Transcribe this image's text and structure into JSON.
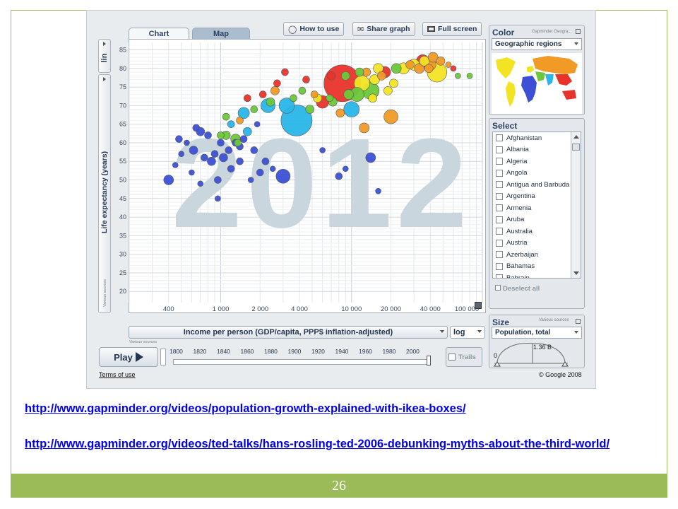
{
  "slide": {
    "page_number": "26",
    "links": [
      "http://www.gapminder.org/videos/population-growth-explained-with-ikea-boxes/",
      "http://www.gapminder.org/videos/ted-talks/hans-rosling-ted-2006-debunking-myths-about-the-third-world/"
    ]
  },
  "tabs": [
    "Chart",
    "Map"
  ],
  "top_buttons": [
    "How to use",
    "Share graph",
    "Full screen"
  ],
  "year": "2012",
  "y_axis": {
    "scale": "lin",
    "label": "Life expectancy (years)",
    "source_note": "Various sources"
  },
  "x_axis": {
    "label": "Income per person (GDP/capita, PPP$ inflation-adjusted)",
    "scale": "log",
    "source_note": "Various sources"
  },
  "color_panel": {
    "title": "Color",
    "source_note": "Gapminder Geogra...",
    "selected": "Geographic regions"
  },
  "select_panel": {
    "title": "Select",
    "countries": [
      "Afghanistan",
      "Albania",
      "Algeria",
      "Angola",
      "Antigua and Barbuda",
      "Argentina",
      "Armenia",
      "Aruba",
      "Australia",
      "Austria",
      "Azerbaijan",
      "Bahamas",
      "Bahrain"
    ],
    "deselect_label": "Deselect all"
  },
  "size_panel": {
    "title": "Size",
    "source_note": "Various sources",
    "selected": "Population, total",
    "min_value": "0",
    "max_value": "1.36 B"
  },
  "timeline": {
    "play_label": "Play",
    "years": [
      "1800",
      "1820",
      "1840",
      "1860",
      "1880",
      "1900",
      "1920",
      "1940",
      "1960",
      "1980",
      "2000"
    ],
    "trails_label": "Trails"
  },
  "terms_label": "Terms of use",
  "copyright": "© Google 2008",
  "chart_data": {
    "type": "scatter",
    "title": "",
    "xlabel": "Income per person (GDP/capita, PPP$ inflation-adjusted)",
    "ylabel": "Life expectancy (years)",
    "x_scale": "log",
    "xlim": [
      200,
      100000
    ],
    "ylim": [
      17,
      87
    ],
    "x_ticks": [
      "400",
      "1 000",
      "2 000",
      "4 000",
      "10 000",
      "20 000",
      "40 000",
      "100 000"
    ],
    "y_ticks": [
      20,
      25,
      30,
      35,
      40,
      45,
      50,
      55,
      60,
      65,
      70,
      75,
      80,
      85
    ],
    "grid": true,
    "year": "2012",
    "colors": {
      "africa": "#3c50d6",
      "south_asia": "#29b6e8",
      "east_asia": "#e8332a",
      "americas": "#6cc83a",
      "europe_central_asia": "#f2e425",
      "middle_east": "#f19a26"
    },
    "points": [
      {
        "x": 8500,
        "y": 76,
        "r": 26,
        "c": "east_asia"
      },
      {
        "x": 3800,
        "y": 66,
        "r": 22,
        "c": "south_asia"
      },
      {
        "x": 45000,
        "y": 79,
        "r": 14,
        "c": "europe_central_asia"
      },
      {
        "x": 3000,
        "y": 51,
        "r": 10,
        "c": "africa"
      },
      {
        "x": 3200,
        "y": 70,
        "r": 11,
        "c": "south_asia"
      },
      {
        "x": 14000,
        "y": 74,
        "r": 12,
        "c": "americas"
      },
      {
        "x": 12000,
        "y": 76,
        "r": 11,
        "c": "europe_central_asia"
      },
      {
        "x": 11000,
        "y": 73,
        "r": 10,
        "c": "americas"
      },
      {
        "x": 6000,
        "y": 71,
        "r": 9,
        "c": "east_asia"
      },
      {
        "x": 2300,
        "y": 70,
        "r": 10,
        "c": "south_asia"
      },
      {
        "x": 10000,
        "y": 69,
        "r": 11,
        "c": "south_asia"
      },
      {
        "x": 20000,
        "y": 67,
        "r": 10,
        "c": "middle_east"
      },
      {
        "x": 1500,
        "y": 68,
        "r": 8,
        "c": "south_asia"
      },
      {
        "x": 35000,
        "y": 82,
        "r": 9,
        "c": "east_asia"
      },
      {
        "x": 40000,
        "y": 81,
        "r": 8,
        "c": "middle_east"
      },
      {
        "x": 33000,
        "y": 80,
        "r": 7,
        "c": "middle_east"
      },
      {
        "x": 36000,
        "y": 82,
        "r": 7,
        "c": "europe_central_asia"
      },
      {
        "x": 30000,
        "y": 81,
        "r": 8,
        "c": "europe_central_asia"
      },
      {
        "x": 25000,
        "y": 80,
        "r": 8,
        "c": "europe_central_asia"
      },
      {
        "x": 22000,
        "y": 80,
        "r": 7,
        "c": "americas"
      },
      {
        "x": 18000,
        "y": 79,
        "r": 8,
        "c": "east_asia"
      },
      {
        "x": 15000,
        "y": 77,
        "r": 7,
        "c": "europe_central_asia"
      },
      {
        "x": 16000,
        "y": 80,
        "r": 7,
        "c": "europe_central_asia"
      },
      {
        "x": 42000,
        "y": 83,
        "r": 7,
        "c": "middle_east"
      },
      {
        "x": 28000,
        "y": 81,
        "r": 6,
        "c": "middle_east"
      },
      {
        "x": 39000,
        "y": 80,
        "r": 6,
        "c": "middle_east"
      },
      {
        "x": 48000,
        "y": 82,
        "r": 6,
        "c": "middle_east"
      },
      {
        "x": 13000,
        "y": 79,
        "r": 6,
        "c": "middle_east"
      },
      {
        "x": 17000,
        "y": 78,
        "r": 6,
        "c": "middle_east"
      },
      {
        "x": 11500,
        "y": 79,
        "r": 6,
        "c": "americas"
      },
      {
        "x": 9000,
        "y": 78,
        "r": 6,
        "c": "americas"
      },
      {
        "x": 7000,
        "y": 78,
        "r": 6,
        "c": "east_asia"
      },
      {
        "x": 21000,
        "y": 76,
        "r": 6,
        "c": "europe_central_asia"
      },
      {
        "x": 19000,
        "y": 74,
        "r": 6,
        "c": "europe_central_asia"
      },
      {
        "x": 14500,
        "y": 72,
        "r": 6,
        "c": "europe_central_asia"
      },
      {
        "x": 9500,
        "y": 73,
        "r": 7,
        "c": "americas"
      },
      {
        "x": 7200,
        "y": 71,
        "r": 6,
        "c": "americas"
      },
      {
        "x": 5500,
        "y": 72,
        "r": 6,
        "c": "europe_central_asia"
      },
      {
        "x": 4800,
        "y": 69,
        "r": 6,
        "c": "americas"
      },
      {
        "x": 6800,
        "y": 72,
        "r": 5,
        "c": "americas"
      },
      {
        "x": 5200,
        "y": 73,
        "r": 5,
        "c": "middle_east"
      },
      {
        "x": 4200,
        "y": 74,
        "r": 5,
        "c": "americas"
      },
      {
        "x": 3600,
        "y": 72,
        "r": 5,
        "c": "americas"
      },
      {
        "x": 2600,
        "y": 74,
        "r": 6,
        "c": "middle_east"
      },
      {
        "x": 2400,
        "y": 71,
        "r": 6,
        "c": "americas"
      },
      {
        "x": 8200,
        "y": 68,
        "r": 6,
        "c": "middle_east"
      },
      {
        "x": 1800,
        "y": 69,
        "r": 5,
        "c": "americas"
      },
      {
        "x": 1600,
        "y": 63,
        "r": 6,
        "c": "south_asia"
      },
      {
        "x": 1200,
        "y": 65,
        "r": 5,
        "c": "south_asia"
      },
      {
        "x": 1400,
        "y": 66,
        "r": 5,
        "c": "middle_east"
      },
      {
        "x": 1300,
        "y": 61,
        "r": 7,
        "c": "americas"
      },
      {
        "x": 1000,
        "y": 62,
        "r": 5,
        "c": "americas"
      },
      {
        "x": 1100,
        "y": 67,
        "r": 5,
        "c": "americas"
      },
      {
        "x": 2100,
        "y": 73,
        "r": 5,
        "c": "east_asia"
      },
      {
        "x": 1600,
        "y": 72,
        "r": 5,
        "c": "east_asia"
      },
      {
        "x": 2700,
        "y": 76,
        "r": 5,
        "c": "east_asia"
      },
      {
        "x": 4500,
        "y": 77,
        "r": 5,
        "c": "east_asia"
      },
      {
        "x": 3100,
        "y": 79,
        "r": 5,
        "c": "east_asia"
      },
      {
        "x": 12500,
        "y": 64,
        "r": 7,
        "c": "middle_east"
      },
      {
        "x": 65000,
        "y": 78,
        "r": 4,
        "c": "americas"
      },
      {
        "x": 80000,
        "y": 78,
        "r": 4,
        "c": "americas"
      },
      {
        "x": 60000,
        "y": 80,
        "r": 4,
        "c": "east_asia"
      },
      {
        "x": 55000,
        "y": 81,
        "r": 4,
        "c": "middle_east"
      },
      {
        "x": 700,
        "y": 63,
        "r": 6,
        "c": "africa"
      },
      {
        "x": 650,
        "y": 64,
        "r": 5,
        "c": "africa"
      },
      {
        "x": 620,
        "y": 58,
        "r": 6,
        "c": "africa"
      },
      {
        "x": 750,
        "y": 56,
        "r": 5,
        "c": "africa"
      },
      {
        "x": 800,
        "y": 62,
        "r": 5,
        "c": "africa"
      },
      {
        "x": 850,
        "y": 55,
        "r": 6,
        "c": "africa"
      },
      {
        "x": 900,
        "y": 57,
        "r": 5,
        "c": "africa"
      },
      {
        "x": 1000,
        "y": 60,
        "r": 5,
        "c": "africa"
      },
      {
        "x": 1050,
        "y": 56,
        "r": 6,
        "c": "africa"
      },
      {
        "x": 1150,
        "y": 58,
        "r": 5,
        "c": "africa"
      },
      {
        "x": 1300,
        "y": 60,
        "r": 5,
        "c": "africa"
      },
      {
        "x": 1400,
        "y": 59,
        "r": 5,
        "c": "africa"
      },
      {
        "x": 1500,
        "y": 61,
        "r": 5,
        "c": "africa"
      },
      {
        "x": 1200,
        "y": 53,
        "r": 5,
        "c": "africa"
      },
      {
        "x": 950,
        "y": 50,
        "r": 5,
        "c": "africa"
      },
      {
        "x": 400,
        "y": 50,
        "r": 7,
        "c": "africa"
      },
      {
        "x": 450,
        "y": 54,
        "r": 4,
        "c": "africa"
      },
      {
        "x": 500,
        "y": 57,
        "r": 4,
        "c": "africa"
      },
      {
        "x": 550,
        "y": 60,
        "r": 4,
        "c": "africa"
      },
      {
        "x": 600,
        "y": 52,
        "r": 4,
        "c": "africa"
      },
      {
        "x": 1800,
        "y": 58,
        "r": 5,
        "c": "africa"
      },
      {
        "x": 2000,
        "y": 52,
        "r": 5,
        "c": "africa"
      },
      {
        "x": 1700,
        "y": 50,
        "r": 4,
        "c": "africa"
      },
      {
        "x": 2200,
        "y": 55,
        "r": 5,
        "c": "africa"
      },
      {
        "x": 2500,
        "y": 53,
        "r": 4,
        "c": "africa"
      },
      {
        "x": 950,
        "y": 45,
        "r": 4,
        "c": "africa"
      },
      {
        "x": 700,
        "y": 49,
        "r": 4,
        "c": "africa"
      },
      {
        "x": 6000,
        "y": 58,
        "r": 4,
        "c": "africa"
      },
      {
        "x": 8000,
        "y": 51,
        "r": 5,
        "c": "africa"
      },
      {
        "x": 9000,
        "y": 53,
        "r": 4,
        "c": "africa"
      },
      {
        "x": 14000,
        "y": 56,
        "r": 7,
        "c": "africa"
      },
      {
        "x": 16000,
        "y": 47,
        "r": 4,
        "c": "africa"
      },
      {
        "x": 1900,
        "y": 65,
        "r": 4,
        "c": "africa"
      },
      {
        "x": 480,
        "y": 61,
        "r": 5,
        "c": "africa"
      },
      {
        "x": 1400,
        "y": 55,
        "r": 5,
        "c": "africa"
      },
      {
        "x": 1100,
        "y": 62,
        "r": 6,
        "c": "americas"
      },
      {
        "x": 1350,
        "y": 60,
        "r": 5,
        "c": "americas"
      }
    ]
  }
}
